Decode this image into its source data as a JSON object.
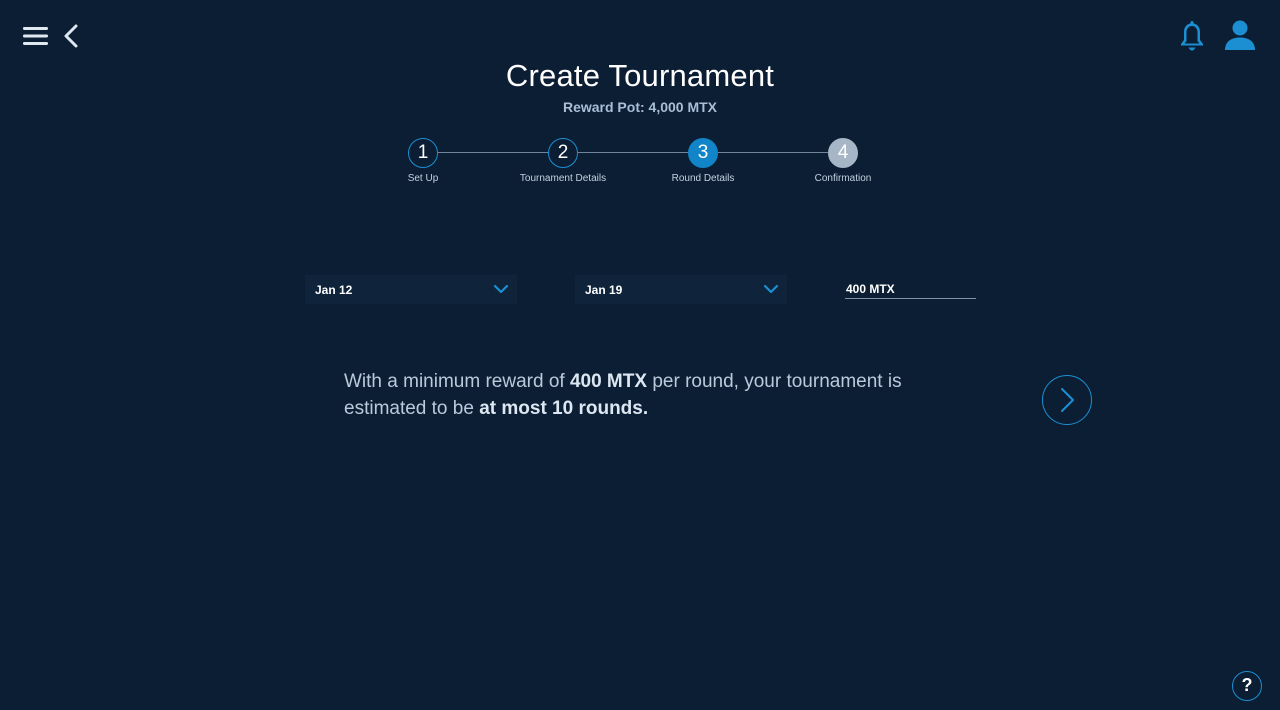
{
  "header": {
    "menu_icon": "hamburger-menu-icon",
    "back_icon": "chevron-left-icon",
    "notifications_icon": "bell-icon",
    "profile_icon": "user-icon"
  },
  "title": "Create Tournament",
  "subtitle": "Reward Pot: 4,000 MTX",
  "stepper": {
    "steps": [
      {
        "number": "1",
        "label": "Set Up",
        "state": "complete"
      },
      {
        "number": "2",
        "label": "Tournament Details",
        "state": "complete"
      },
      {
        "number": "3",
        "label": "Round Details",
        "state": "active"
      },
      {
        "number": "4",
        "label": "Confirmation",
        "state": "pending"
      }
    ]
  },
  "form": {
    "start_date": "Jan 12",
    "end_date": "Jan 19",
    "min_reward": "400 MTX"
  },
  "info": {
    "part1": "With a minimum reward of ",
    "reward": "400 MTX",
    "part2": " per round, your tournament is estimated to be ",
    "rounds": "at most 10 rounds."
  },
  "help_label": "?",
  "colors": {
    "background": "#0b1e33",
    "accent": "#1c8fd3",
    "active_step": "#1185c8",
    "pending_step": "#a7b6c6"
  }
}
